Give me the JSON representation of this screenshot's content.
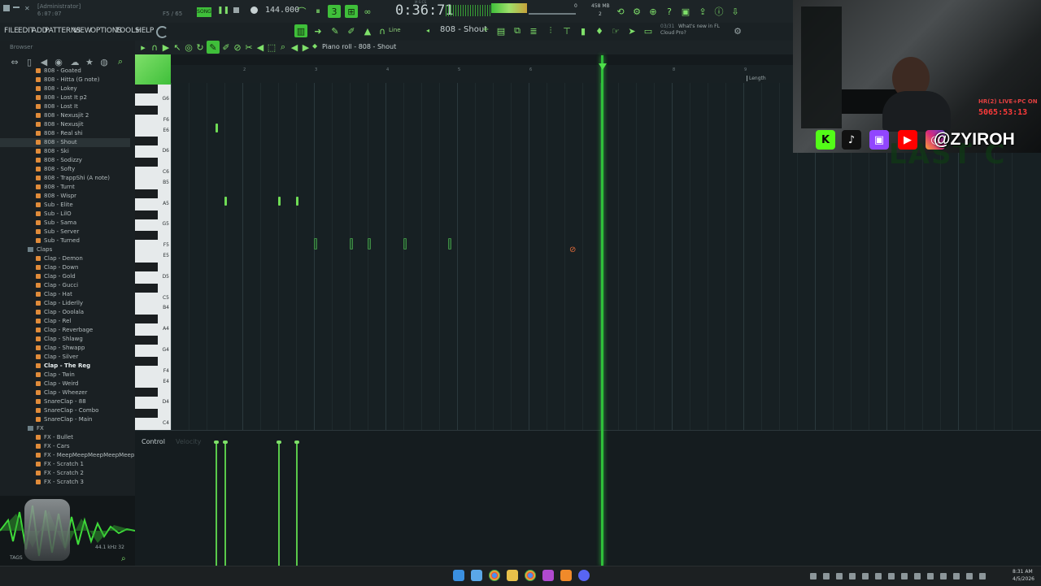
{
  "topbar": {
    "admin_label": "[Administrator]",
    "project_time": "6:07:07",
    "key_label": "F5 / 65",
    "song_label": "SONG",
    "tempo": "144.000",
    "clock": "0:36:71",
    "clock_label": "M:S:CS",
    "memory": "458 MB",
    "cpu_poly": "2",
    "cpu_count": "0"
  },
  "menu": [
    "FILE",
    "EDIT",
    "ADD",
    "PATTERNS",
    "VIEW",
    "OPTIONS",
    "TOOLS",
    "HELP"
  ],
  "toolbar": {
    "snap_label": "Line",
    "pattern_label": "808 - Shout",
    "news_date": "03/31",
    "news_text": "What's new in FL Cloud Pro?"
  },
  "piano_roll": {
    "title": "Piano roll - 808 - Shout",
    "ruler_marks": [
      "2",
      "3",
      "4",
      "5",
      "6",
      "7",
      "8",
      "9"
    ],
    "length_label": "Length",
    "key_labels": [
      "G6",
      "F6",
      "E6",
      "D6",
      "C6",
      "B5",
      "A5",
      "G5",
      "F5",
      "E5",
      "D5",
      "C5",
      "B4",
      "A4",
      "G4",
      "F4",
      "E4",
      "D4",
      "C4"
    ],
    "control_label": "Control",
    "control_param": "Velocity"
  },
  "browser": {
    "title": "Browser",
    "items": [
      {
        "label": "808 - Goated",
        "type": "file"
      },
      {
        "label": "808 - Hitta (G note)",
        "type": "file"
      },
      {
        "label": "808 - Lokey",
        "type": "file"
      },
      {
        "label": "808 - Lost It p2",
        "type": "file"
      },
      {
        "label": "808 - Lost It",
        "type": "file"
      },
      {
        "label": "808 - Nexusjit 2",
        "type": "file"
      },
      {
        "label": "808 - Nexusjit",
        "type": "file"
      },
      {
        "label": "808 - Real shi",
        "type": "file"
      },
      {
        "label": "808 - Shout",
        "type": "file",
        "selected": true
      },
      {
        "label": "808 - Ski",
        "type": "file"
      },
      {
        "label": "808 - Sodizzy",
        "type": "file"
      },
      {
        "label": "808 - Softy",
        "type": "file"
      },
      {
        "label": "808 - TrappShi (A note)",
        "type": "file"
      },
      {
        "label": "808 - Turnt",
        "type": "file"
      },
      {
        "label": "808 - Wispr",
        "type": "file"
      },
      {
        "label": "Sub - Elite",
        "type": "file"
      },
      {
        "label": "Sub - LilO",
        "type": "file"
      },
      {
        "label": "Sub - Sama",
        "type": "file"
      },
      {
        "label": "Sub - Server",
        "type": "file"
      },
      {
        "label": "Sub - Turned",
        "type": "file"
      },
      {
        "label": "Claps",
        "type": "folder"
      },
      {
        "label": "Clap - Demon",
        "type": "file"
      },
      {
        "label": "Clap - Down",
        "type": "file"
      },
      {
        "label": "Clap - Gold",
        "type": "file"
      },
      {
        "label": "Clap - Gucci",
        "type": "file"
      },
      {
        "label": "Clap - Hat",
        "type": "file"
      },
      {
        "label": "Clap - Liderlly",
        "type": "file"
      },
      {
        "label": "Clap - Ooolala",
        "type": "file"
      },
      {
        "label": "Clap - Rel",
        "type": "file"
      },
      {
        "label": "Clap - Reverbage",
        "type": "file"
      },
      {
        "label": "Clap - Shlawg",
        "type": "file"
      },
      {
        "label": "Clap - Shwapp",
        "type": "file"
      },
      {
        "label": "Clap - Silver",
        "type": "file"
      },
      {
        "label": "Clap - The Reg",
        "type": "file",
        "highlight": true
      },
      {
        "label": "Clap - Twin",
        "type": "file"
      },
      {
        "label": "Clap - Weird",
        "type": "file"
      },
      {
        "label": "Clap - Wheezer",
        "type": "file"
      },
      {
        "label": "SnareClap - 88",
        "type": "file"
      },
      {
        "label": "SnareClap - Combo",
        "type": "file"
      },
      {
        "label": "SnareClap - Main",
        "type": "file"
      },
      {
        "label": "FX",
        "type": "folder"
      },
      {
        "label": "FX - Bullet",
        "type": "file"
      },
      {
        "label": "FX - Cars",
        "type": "file"
      },
      {
        "label": "FX - MeepMeepMeepMeepMeep",
        "type": "file"
      },
      {
        "label": "FX - Scratch 1",
        "type": "file"
      },
      {
        "label": "FX - Scratch 2",
        "type": "file"
      },
      {
        "label": "FX - Scratch 3",
        "type": "file"
      }
    ],
    "sample_info": "44.1 kHz 32",
    "tags_label": "TAGS"
  },
  "notes": [
    {
      "bar": 1.62,
      "pitch": "E6",
      "style": "on"
    },
    {
      "bar": 1.75,
      "pitch": "A5",
      "style": "on"
    },
    {
      "bar": 2.5,
      "pitch": "A5",
      "style": "on"
    },
    {
      "bar": 2.75,
      "pitch": "A5",
      "style": "on"
    },
    {
      "bar": 3.0,
      "pitch": "F5",
      "style": "dim"
    },
    {
      "bar": 3.5,
      "pitch": "F5",
      "style": "dim"
    },
    {
      "bar": 3.75,
      "pitch": "F5",
      "style": "dim"
    },
    {
      "bar": 4.25,
      "pitch": "F5",
      "style": "dim"
    },
    {
      "bar": 4.88,
      "pitch": "F5",
      "style": "dim"
    }
  ],
  "velocities": [
    0.8,
    0.8,
    0.8,
    0.8
  ],
  "stream": {
    "live_label": "HR(2) LIVE+PC ON",
    "live_timer": "5065:53:13",
    "handle": "@ZYIROH"
  },
  "taskbar": {
    "time": "8:31 AM",
    "date": "4/5/2026"
  },
  "colors": {
    "accent": "#3fbf3a",
    "note": "#6fdc55",
    "file_icon": "#e08b3a"
  }
}
